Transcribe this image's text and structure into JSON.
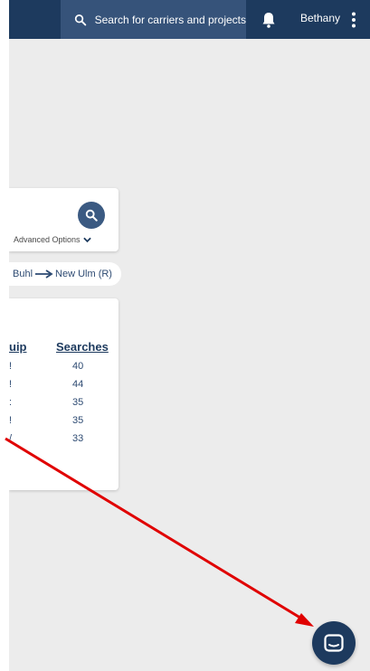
{
  "topbar": {
    "search_placeholder": "Search for carriers and projects",
    "username": "Bethany",
    "icons": {
      "search": "search-icon",
      "bell": "bell-icon",
      "menu": "kebab-menu-icon"
    }
  },
  "search_card": {
    "advanced_options_label": "Advanced Options",
    "icons": {
      "search": "search-icon",
      "chevron": "chevron-down-icon"
    }
  },
  "lane": {
    "origin": "Buhl",
    "destination": "New Ulm (R)"
  },
  "table": {
    "columns": [
      "uip",
      "Searches"
    ],
    "rows": [
      {
        "equip": "!",
        "searches": "40"
      },
      {
        "equip": "!",
        "searches": "44"
      },
      {
        "equip": ":",
        "searches": "35"
      },
      {
        "equip": "!",
        "searches": "35"
      },
      {
        "equip": "/",
        "searches": "33"
      }
    ]
  },
  "chat": {
    "icon": "chat-icon"
  },
  "colors": {
    "nav_bg": "#1d3a5e",
    "search_bg": "#36537a",
    "page_bg": "#ececec",
    "accent": "#2d4a72",
    "annotation": "#e00000"
  }
}
